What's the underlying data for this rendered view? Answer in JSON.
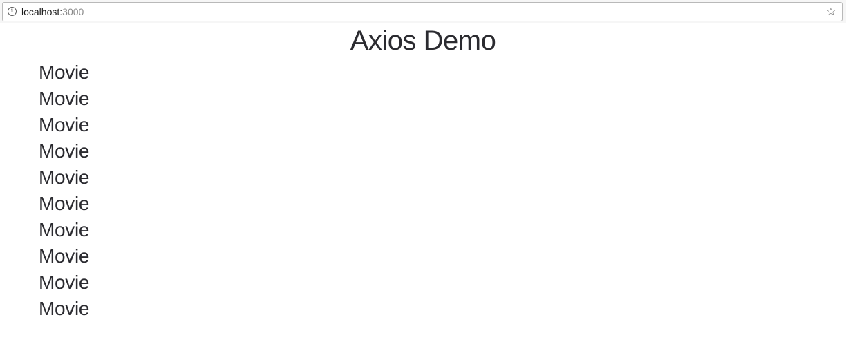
{
  "browser": {
    "url_host": "localhost:",
    "url_port": "3000",
    "info_icon": "info-icon",
    "bookmark_icon": "star-icon"
  },
  "main": {
    "title": "Axios Demo",
    "movies": [
      {
        "label": "Movie"
      },
      {
        "label": "Movie"
      },
      {
        "label": "Movie"
      },
      {
        "label": "Movie"
      },
      {
        "label": "Movie"
      },
      {
        "label": "Movie"
      },
      {
        "label": "Movie"
      },
      {
        "label": "Movie"
      },
      {
        "label": "Movie"
      },
      {
        "label": "Movie"
      }
    ]
  }
}
